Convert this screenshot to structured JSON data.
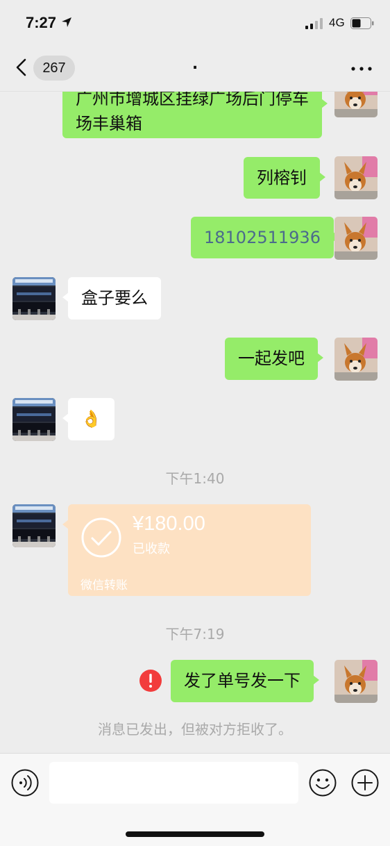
{
  "status_bar": {
    "time": "7:27",
    "network": "4G"
  },
  "nav": {
    "back_count": "267",
    "title": "."
  },
  "messages": {
    "m1": "广州市增城区挂绿广场后门停车场丰巢箱",
    "m2": "列榕钊",
    "m3": "18102511936",
    "m4": "盒子要么",
    "m5": "一起发吧",
    "m6": "👌",
    "time1": "下午1:40",
    "transfer": {
      "amount": "¥180.00",
      "status": "已收款",
      "label": "微信转账"
    },
    "time2": "下午7:19",
    "m7": "发了单号发一下",
    "notice": "消息已发出，但被对方拒收了。"
  },
  "colors": {
    "my_bubble": "#95ec69",
    "other_bubble": "#ffffff",
    "transfer_bg": "#fde1c3",
    "error": "#f23c3c"
  },
  "icons": {
    "back": "chevron-left-icon",
    "more": "more-dots-icon",
    "voice": "voice-icon",
    "emoji": "emoji-icon",
    "plus": "plus-icon",
    "error": "error-icon",
    "check": "check-circle-icon"
  }
}
